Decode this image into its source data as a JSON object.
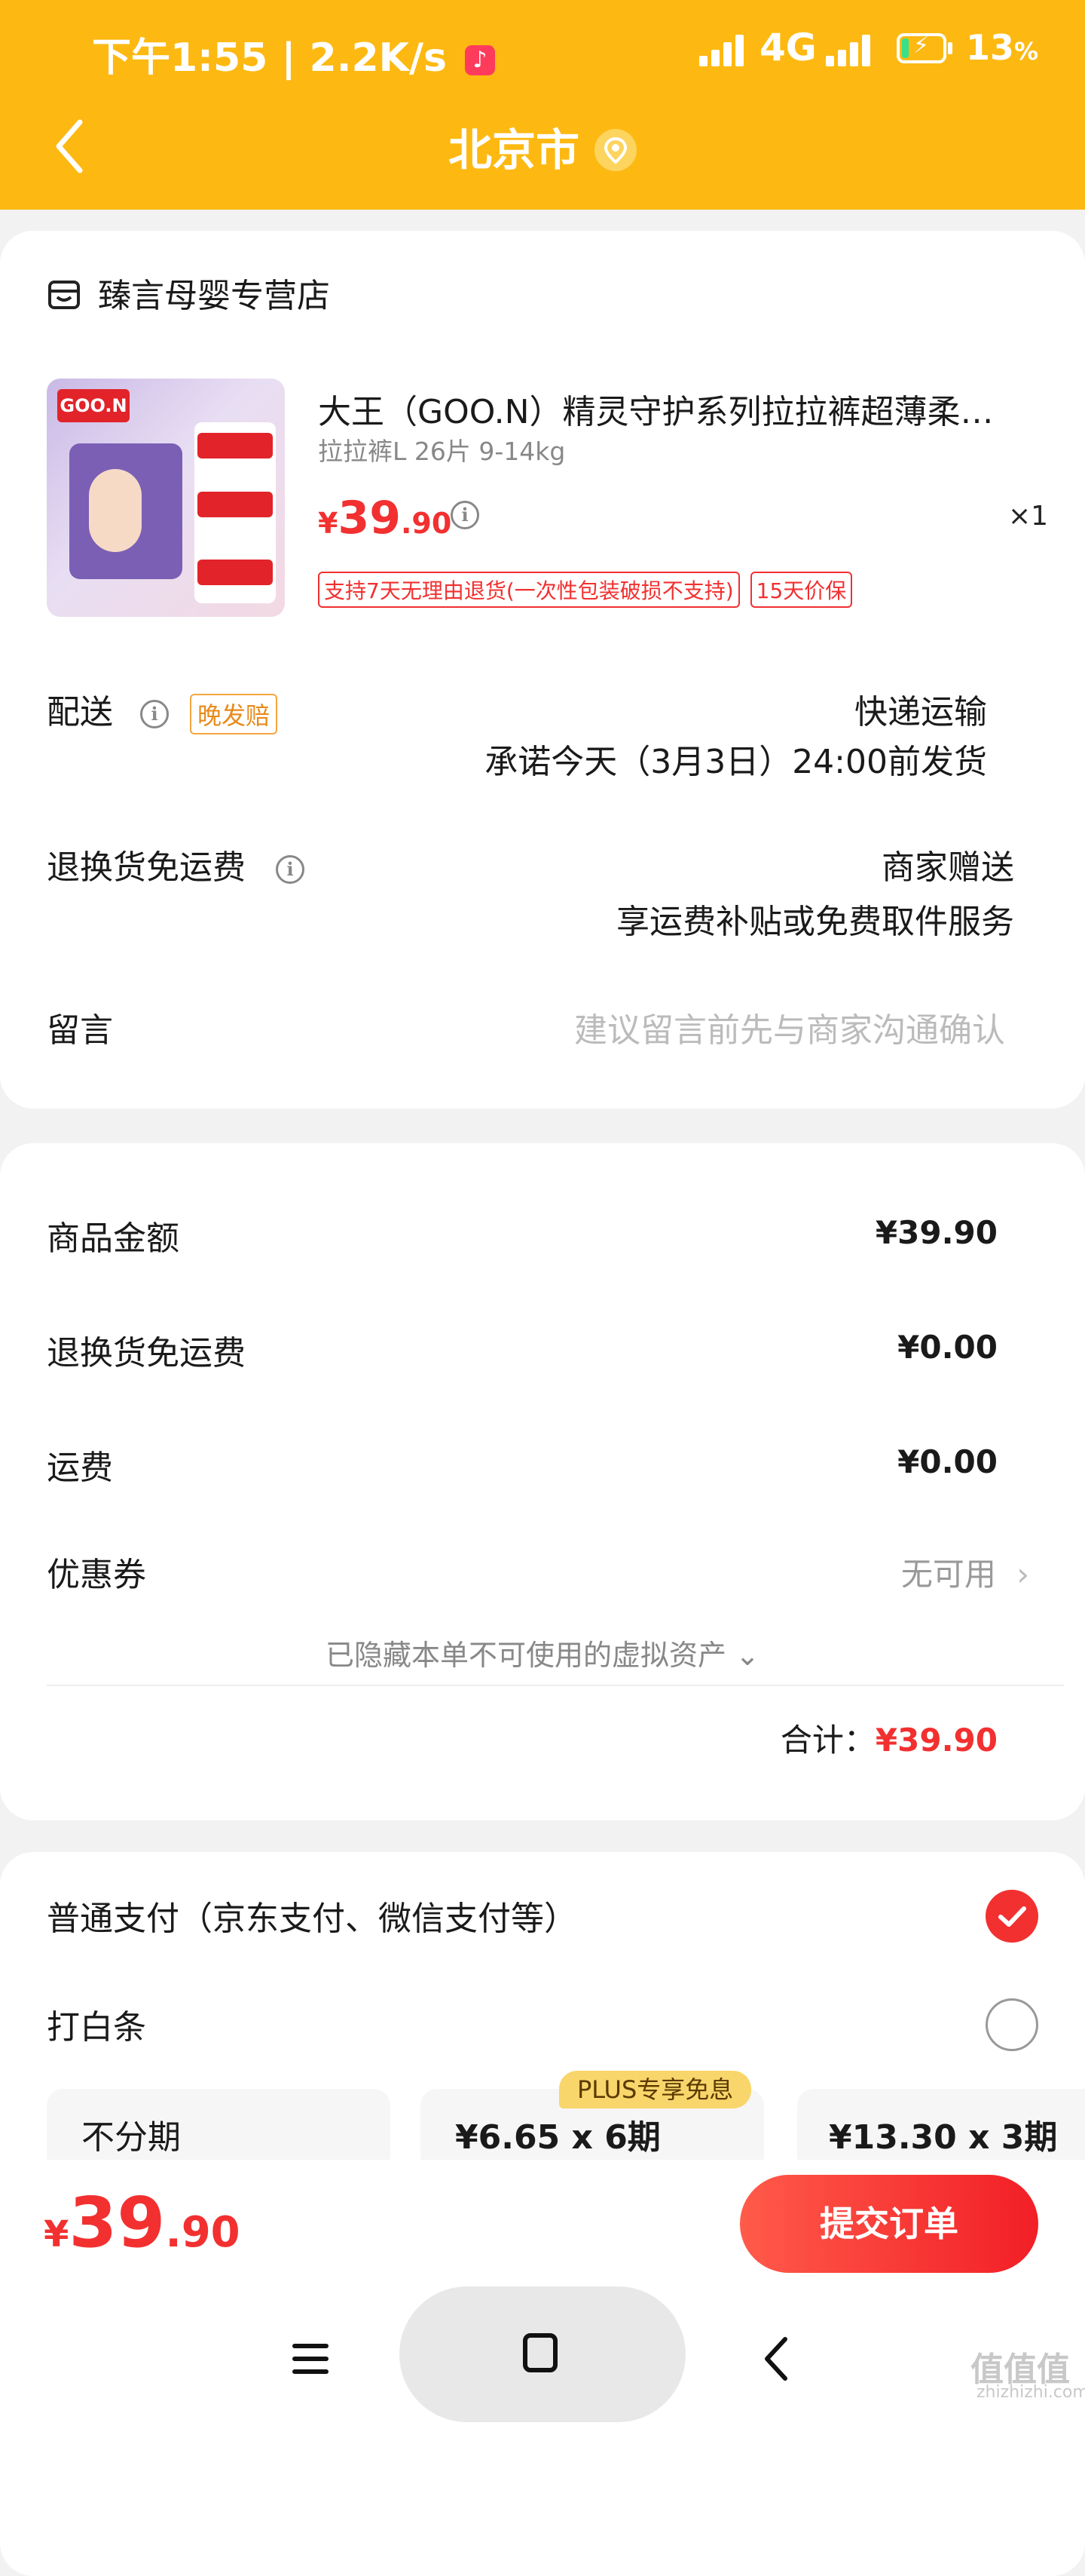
{
  "status_bar": {
    "time_speed": "下午1:55 | 2.2K/s",
    "network": "4G",
    "battery": "13",
    "battery_unit": "%"
  },
  "header": {
    "title": "北京市",
    "back_icon": "chevron-left-icon",
    "location_icon": "location-pin-icon"
  },
  "store": {
    "name": "臻言母婴专营店"
  },
  "product": {
    "name": "大王（GOO.N）精灵守护系列拉拉裤超薄柔…",
    "spec": "拉拉裤L 26片 9-14kg",
    "price_currency": "¥",
    "price_int": "39",
    "price_dec": ".90",
    "quantity": "×1",
    "tags": [
      "支持7天无理由退货(一次性包装破损不支持)",
      "15天价保"
    ],
    "image_logo": "GOO.N"
  },
  "delivery": {
    "label": "配送",
    "badge": "晚发赔",
    "method": "快递运输",
    "promise": "承诺今天（3月3日）24:00前发货"
  },
  "return_shipping": {
    "label": "退换货免运费",
    "value": "商家赠送",
    "detail": "享运费补贴或免费取件服务"
  },
  "message": {
    "label": "留言",
    "placeholder": "建议留言前先与商家沟通确认"
  },
  "summary": {
    "goods_label": "商品金额",
    "goods_value": "¥39.90",
    "return_label": "退换货免运费",
    "return_value": "¥0.00",
    "shipping_label": "运费",
    "shipping_value": "¥0.00",
    "coupon_label": "优惠券",
    "coupon_value": "无可用",
    "hidden_note": "已隐藏本单不可使用的虚拟资产",
    "total_label": "合计：",
    "total_value": "¥39.90"
  },
  "payment": {
    "normal_label": "普通支付（京东支付、微信支付等）",
    "baitiao_label": "打白条",
    "plus_badge": "PLUS专享免息",
    "installments": [
      {
        "label": "不分期"
      },
      {
        "label": "¥6.65 x 6期"
      },
      {
        "label": "¥13.30 x 3期"
      }
    ]
  },
  "bottom_bar": {
    "currency": "¥",
    "price_int": "39",
    "price_dec": ".90",
    "submit_label": "提交订单"
  },
  "colors": {
    "header_yellow": "#fdb912",
    "price_red": "#f23030",
    "badge_orange": "#e88a1a"
  },
  "watermark": {
    "text": "值值值",
    "url": "zhizhizhi.com"
  }
}
